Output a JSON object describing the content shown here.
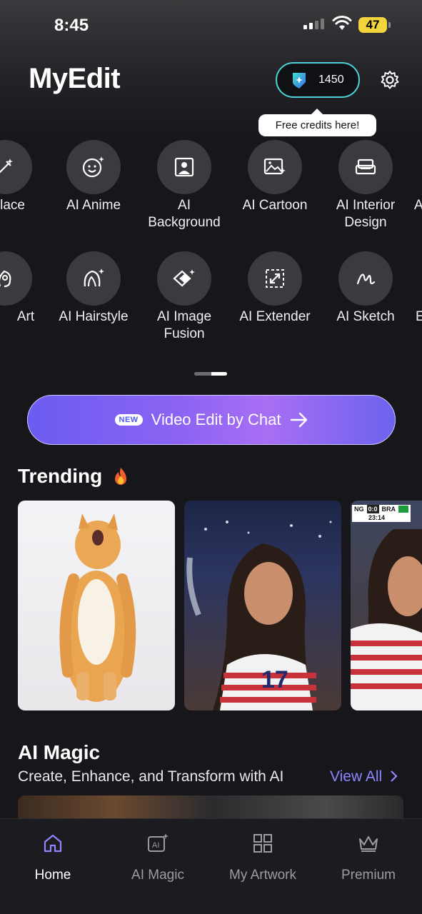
{
  "status_bar": {
    "time": "8:45",
    "battery": "47"
  },
  "header": {
    "app_title": "MyEdit",
    "credits": "1450",
    "tooltip": "Free credits here!"
  },
  "tools_row1": [
    {
      "label": "eplace",
      "icon": "wand-icon"
    },
    {
      "label": "AI Anime",
      "icon": "smiley-sparkle-icon"
    },
    {
      "label": "AI\nBackground",
      "icon": "portrait-frame-icon"
    },
    {
      "label": "AI Cartoon",
      "icon": "image-sparkle-icon"
    },
    {
      "label": "AI Interior\nDesign",
      "icon": "sofa-icon"
    },
    {
      "label": "A",
      "icon": ""
    }
  ],
  "tools_row2": [
    {
      "label": "Art",
      "icon": "head-icon"
    },
    {
      "label": "AI Hairstyle",
      "icon": "hair-icon"
    },
    {
      "label": "AI Image\nFusion",
      "icon": "layers-icon"
    },
    {
      "label": "AI Extender",
      "icon": "expand-icon"
    },
    {
      "label": "AI Sketch",
      "icon": "squiggle-icon"
    },
    {
      "label": "E",
      "icon": ""
    }
  ],
  "video_button": {
    "badge": "NEW",
    "label": "Video Edit by Chat"
  },
  "trending": {
    "title": "Trending",
    "scoreboard": {
      "team1": "NG",
      "score": "0:0",
      "team2": "BRA",
      "clock": "23:14"
    },
    "jersey_number": "17"
  },
  "ai_magic": {
    "title": "AI Magic",
    "subtitle": "Create, Enhance, and Transform with AI",
    "view_all": "View All"
  },
  "nav": [
    {
      "label": "Home",
      "icon": "home-icon",
      "active": true
    },
    {
      "label": "AI Magic",
      "icon": "ai-sparkle-icon",
      "active": false
    },
    {
      "label": "My Artwork",
      "icon": "grid-icon",
      "active": false
    },
    {
      "label": "Premium",
      "icon": "crown-icon",
      "active": false
    }
  ],
  "colors": {
    "accent": "#8e86ff",
    "credit_border": "#4fd1d9",
    "background": "#17161b"
  }
}
